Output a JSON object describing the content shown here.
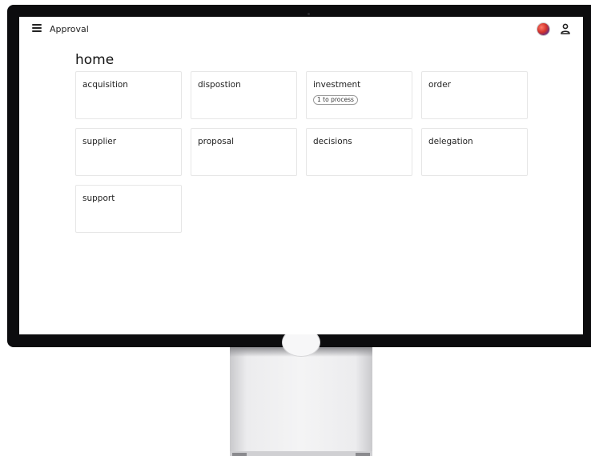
{
  "app": {
    "title": "Approval"
  },
  "page": {
    "title": "home"
  },
  "cards": [
    {
      "label": "acquisition"
    },
    {
      "label": "dispostion"
    },
    {
      "label": "investment",
      "badge": "1 to process"
    },
    {
      "label": "order"
    },
    {
      "label": "supplier"
    },
    {
      "label": "proposal"
    },
    {
      "label": "decisions"
    },
    {
      "label": "delegation"
    },
    {
      "label": "support"
    }
  ],
  "icons": {
    "menu": "hamburger-menu-icon",
    "avatar": "flag-avatar",
    "user": "person-icon"
  },
  "colors": {
    "bezel": "#0c0c0e",
    "screen_background": "#ffffff",
    "card_border": "#e6e6e6",
    "text": "#222222"
  }
}
